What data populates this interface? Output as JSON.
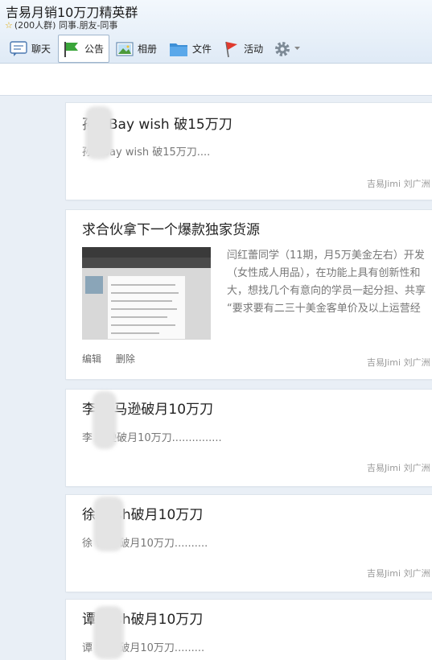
{
  "group": {
    "title": "吉易月销10万刀精英群",
    "subtitle": "(200人群) 同事.朋友-同事"
  },
  "toolbar": {
    "chat": "聊天",
    "announcement": "公告",
    "album": "相册",
    "files": "文件",
    "activity": "活动"
  },
  "posts": [
    {
      "title": "孙 eBay wish 破15万刀",
      "summary": "孙 eBay wish 破15万刀....",
      "author": "吉易Jimi 刘广洲"
    },
    {
      "title": "求合伙拿下一个爆款独家货源",
      "excerpt": [
        "闫红蕾同学（11期，月5万美金左右）开发",
        "（女性成人用品），在功能上具有创新性和",
        "大，想找几个有意向的学员一起分担、共享",
        "“要求要有二三十美金客单价及以上运营经"
      ],
      "actions": {
        "edit": "编辑",
        "delete": "删除"
      },
      "author": "吉易Jimi 刘广洲"
    },
    {
      "title": "李 亚马逊破月10万刀",
      "summary": "李 马逊破月10万刀...............",
      "author": "吉易Jimi 刘广洲"
    },
    {
      "title": "徐 wish破月10万刀",
      "summary": "徐 wish破月10万刀..........",
      "author": "吉易Jimi 刘广洲"
    },
    {
      "title": "谭 wish破月10万刀",
      "summary": "谭 wish破月10万刀........."
    }
  ]
}
